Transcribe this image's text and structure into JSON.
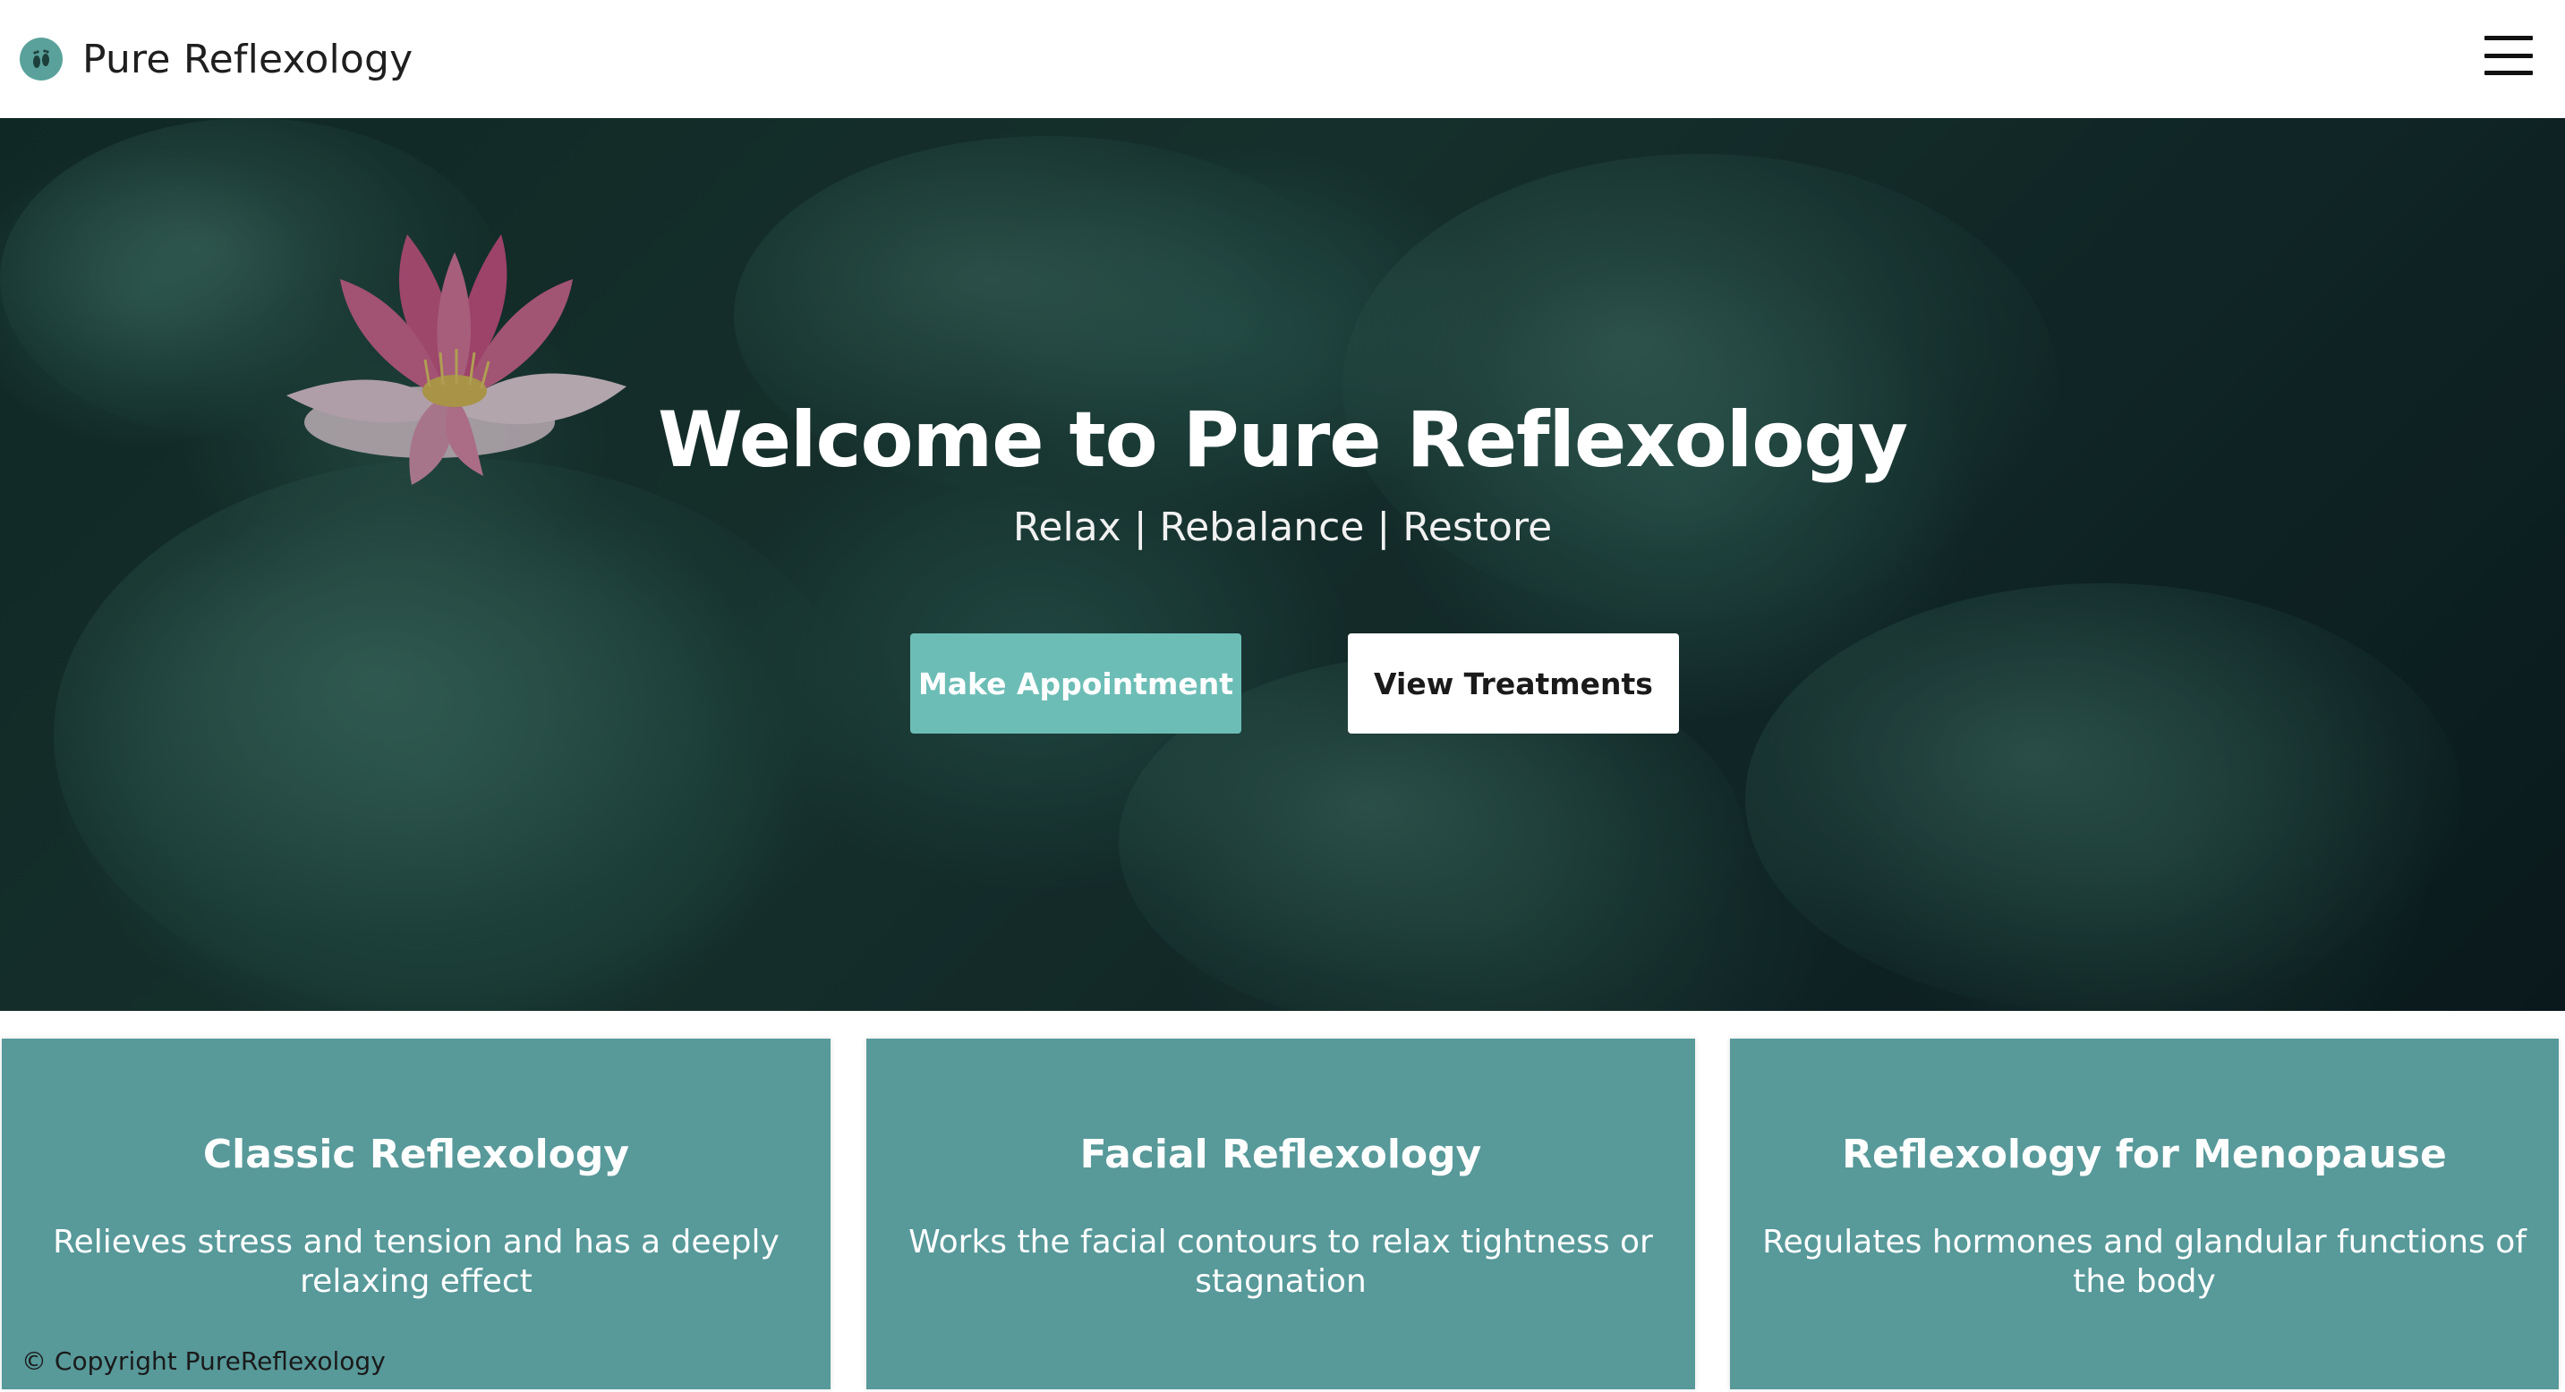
{
  "header": {
    "brand_name": "Pure Reflexology",
    "logo_icon": "feet-icon",
    "menu_icon": "hamburger-menu-icon"
  },
  "hero": {
    "title": "Welcome to Pure Reflexology",
    "tagline": "Relax | Rebalance | Restore",
    "primary_button": "Make Appointment",
    "secondary_button": "View Treatments"
  },
  "treatments": [
    {
      "title": "Classic Reflexology",
      "description": "Relieves stress and tension and has a deeply relaxing effect"
    },
    {
      "title": "Facial Reflexology",
      "description": "Works the facial contours to relax tightness or stagnation"
    },
    {
      "title": "Reflexology for Menopause",
      "description": "Regulates hormones and glandular functions of the body"
    }
  ],
  "footer": {
    "copyright": "© Copyright PureReflexology"
  },
  "colors": {
    "accent": "#6cbdb6",
    "card": "#58999a",
    "header_bg": "#ffffff"
  }
}
